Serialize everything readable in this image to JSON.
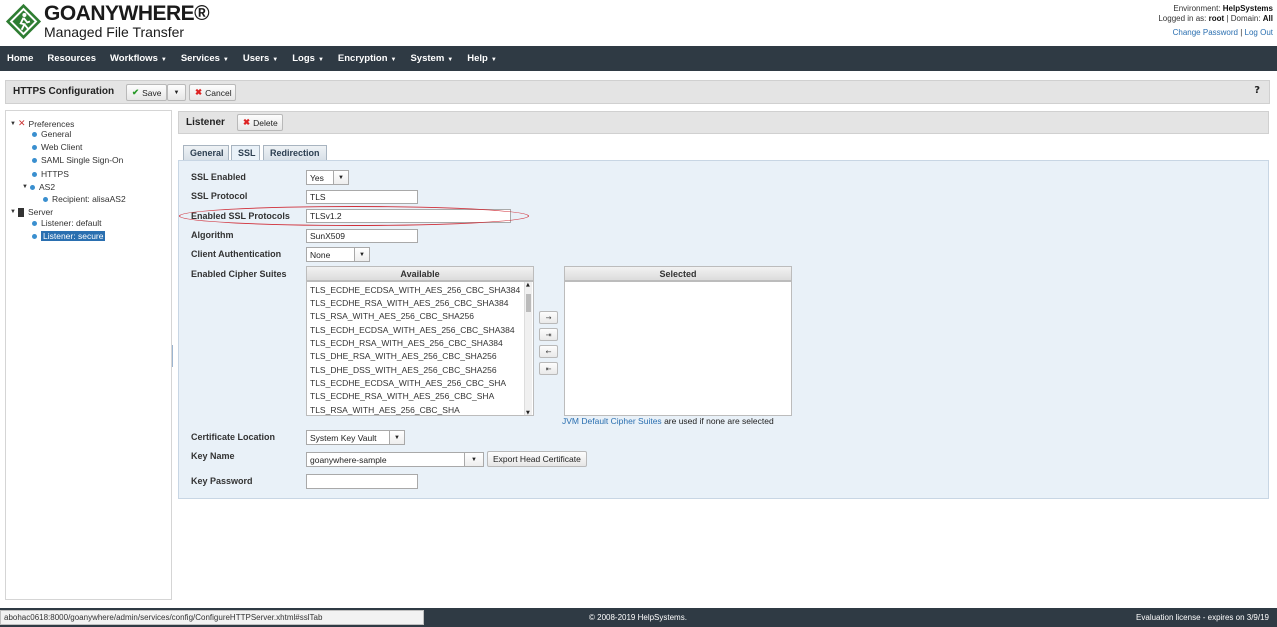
{
  "header": {
    "brand_line1": "GOANYWHERE®",
    "brand_line2": "Managed File Transfer",
    "env_label": "Environment:",
    "env_value": "HelpSystems",
    "logged_label": "Logged in as:",
    "logged_user": "root",
    "domain_label": "| Domain:",
    "domain_value": "All",
    "change_password": "Change Password",
    "separator": "|",
    "log_out": "Log Out"
  },
  "nav": {
    "items": [
      "Home",
      "Resources",
      "Workflows",
      "Services",
      "Users",
      "Logs",
      "Encryption",
      "System",
      "Help"
    ],
    "dropdown": [
      false,
      false,
      true,
      true,
      true,
      true,
      true,
      true,
      true
    ]
  },
  "titlebar": {
    "title": "HTTPS Configuration",
    "save": "Save",
    "cancel": "Cancel",
    "help": "?"
  },
  "tree": {
    "preferences": "Preferences",
    "general": "General",
    "web_client": "Web Client",
    "saml": "SAML Single Sign-On",
    "https": "HTTPS",
    "as2": "AS2",
    "recipient": "Recipient: alisaAS2",
    "server": "Server",
    "listener_default": "Listener: default",
    "listener_secure": "Listener: secure"
  },
  "listener": {
    "title": "Listener",
    "delete": "Delete"
  },
  "tabs": [
    "General",
    "SSL",
    "Redirection"
  ],
  "form": {
    "ssl_enabled_label": "SSL Enabled",
    "ssl_enabled_value": "Yes",
    "ssl_protocol_label": "SSL Protocol",
    "ssl_protocol_value": "TLS",
    "enabled_protocols_label": "Enabled SSL Protocols",
    "enabled_protocols_value": "TLSv1.2",
    "algorithm_label": "Algorithm",
    "algorithm_value": "SunX509",
    "client_auth_label": "Client Authentication",
    "client_auth_value": "None",
    "cipher_label": "Enabled Cipher Suites",
    "available_head": "Available",
    "selected_head": "Selected",
    "jvm_link": "JVM Default Cipher Suites",
    "jvm_text": "are used if none are selected",
    "cert_location_label": "Certificate Location",
    "cert_location_value": "System Key Vault",
    "key_name_label": "Key Name",
    "key_name_value": "goanywhere-sample",
    "export_button": "Export Head Certificate",
    "key_password_label": "Key Password",
    "key_password_value": ""
  },
  "ciphers": [
    "TLS_ECDHE_ECDSA_WITH_AES_256_CBC_SHA384",
    "TLS_ECDHE_RSA_WITH_AES_256_CBC_SHA384",
    "TLS_RSA_WITH_AES_256_CBC_SHA256",
    "TLS_ECDH_ECDSA_WITH_AES_256_CBC_SHA384",
    "TLS_ECDH_RSA_WITH_AES_256_CBC_SHA384",
    "TLS_DHE_RSA_WITH_AES_256_CBC_SHA256",
    "TLS_DHE_DSS_WITH_AES_256_CBC_SHA256",
    "TLS_ECDHE_ECDSA_WITH_AES_256_CBC_SHA",
    "TLS_ECDHE_RSA_WITH_AES_256_CBC_SHA",
    "TLS_RSA_WITH_AES_256_CBC_SHA"
  ],
  "move_buttons": [
    "→",
    "⇥",
    "←",
    "⇤"
  ],
  "footer": {
    "url": "abohac0618:8000/goanywhere/admin/services/config/ConfigureHTTPServer.xhtml#sslTab",
    "copyright": "© 2008-2019 HelpSystems.",
    "license": "Evaluation license - expires on 3/9/19"
  }
}
